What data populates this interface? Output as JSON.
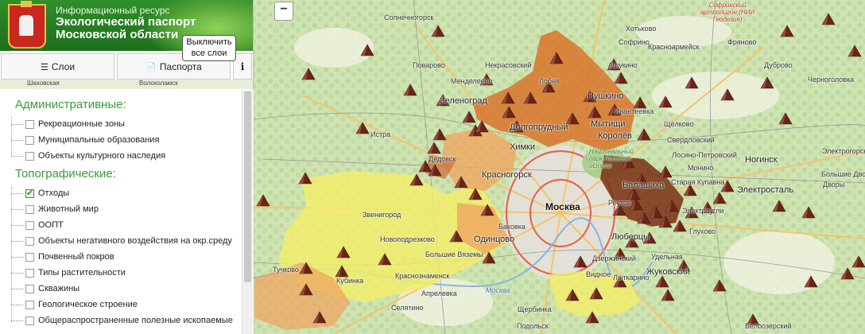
{
  "header": {
    "subtitle": "Информационный ресурс",
    "title_line1": "Экологический паспорт",
    "title_line2": "Московской области"
  },
  "tooltip": {
    "line1": "Выключить",
    "line2": "все слои"
  },
  "toolbar": {
    "layers_label": "Слои",
    "passport_label": "Паспорта",
    "info_label": "i"
  },
  "strip_labels": [
    "Шаховская",
    "Волоколамск"
  ],
  "layers": {
    "admin_title": "Административные:",
    "admin_items": [
      {
        "label": "Рекреационные зоны",
        "checked": false
      },
      {
        "label": "Муниципальные образования",
        "checked": false
      },
      {
        "label": "Объекты культурного наследия",
        "checked": false
      }
    ],
    "topo_title": "Топографические:",
    "topo_items": [
      {
        "label": "Отходы",
        "checked": true
      },
      {
        "label": "Животный мир",
        "checked": false
      },
      {
        "label": "ООПТ",
        "checked": false
      },
      {
        "label": "Объекты негативного воздействия на окр.среду",
        "checked": false
      },
      {
        "label": "Почвенный покров",
        "checked": false
      },
      {
        "label": "Типы растительности",
        "checked": false
      },
      {
        "label": "Скважины",
        "checked": false
      },
      {
        "label": "Геологическое строение",
        "checked": false
      },
      {
        "label": "Общераспространенные полезные ископаемые",
        "checked": false
      }
    ]
  },
  "map": {
    "zoom_out": "−",
    "labels": {
      "solnechnogorsk": "Солнечногорск",
      "zelenograd": "Зеленоград",
      "lobnya": "Лобня",
      "khimki": "Химки",
      "dolgoprudny": "Долгопрудный",
      "moscow": "Москва",
      "mytishchi": "Мытищи",
      "pushkino": "Пушкино",
      "korolev": "Королёв",
      "balashikha": "Балашиха",
      "lyubertsy": "Люберцы",
      "zhukovsky": "Жуковский",
      "noginsk": "Ногинск",
      "elektrostal": "Электросталь",
      "krasnogorsk": "Красногорск",
      "odintsovo": "Одинцово",
      "kubinka": "Кубинка",
      "istra": "Истра",
      "dedovsk": "Дедовск",
      "zvenigorod": "Звенигород",
      "krasnoarmeysk": "Красноармейск",
      "sofrino": "Софрино",
      "fryanovo": "Фряново",
      "dubrovo": "Дуброво",
      "ivanteevka": "Ивантеевка",
      "shchelkovo": "Щёлково",
      "losino": "Лосино-Петровский",
      "elektrougli": "Электроугли",
      "staraya_kupavna": "Старая Купавна",
      "reutov": "Реутов",
      "dzerzhinsky": "Дзержинский",
      "lytkarino": "Лыткарино",
      "aprelevka": "Апрелевка",
      "selyatino": "Селятино",
      "tuchkovo": "Тучково",
      "shcherbinka": "Щербинка",
      "podolsk": "Подольск",
      "vidnoe": "Видное",
      "moskva_river": "Москва",
      "losiny_ostrov": "Национальный парк Лосиный остров",
      "sofrinsky": "Софринский артполигон (НИИ Геодезия)",
      "nekrasovsky": "Некрасовский",
      "povarovo": "Поварово",
      "mendeleevo": "Менделеево",
      "monino": "Монино",
      "sverdlovsky": "Свердловский",
      "bolshie_vyazemy": "Большие Вяземы",
      "novopodrezkovo": "Новоподрезково",
      "khotkovo": "Хотьково",
      "ashukino": "Ашукино",
      "elektrogorsk": "Электрогорск",
      "belozersky": "Белоозерский",
      "udelnaya": "Удельная",
      "krasnogorsk_sm": "Краснознаменск",
      "bakovka": "Баковка",
      "glukhovo": "Глухово",
      "dvory": "Дворы",
      "bolshie_dvory": "Большие Дворы",
      "chernogolovka": "Черноголовка"
    },
    "marker_type": "waste-triangle-icon",
    "colors": {
      "district_dark": "#7a2f14",
      "district_orange": "#d9742b",
      "district_light_orange": "#efa660",
      "district_yellow": "#f2ee6a",
      "marker": "#6b2418"
    }
  }
}
